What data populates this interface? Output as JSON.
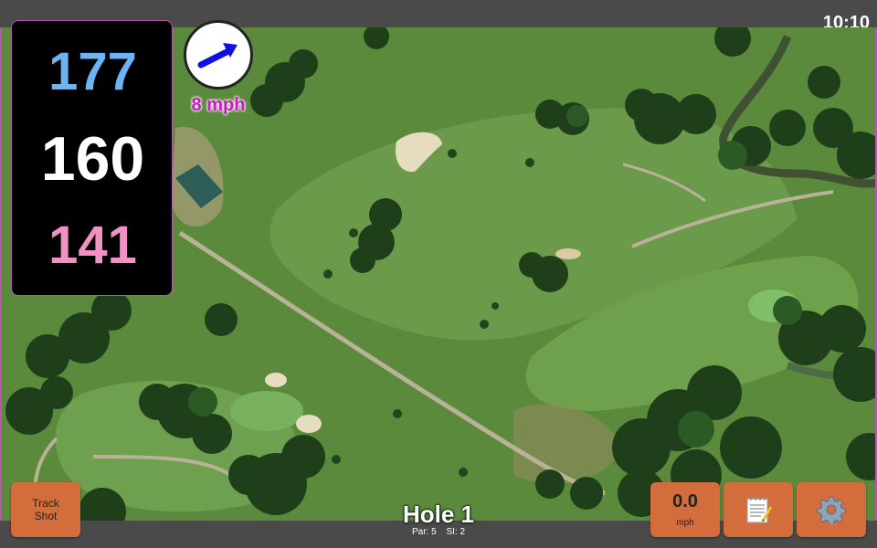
{
  "status": {
    "time": "10:10"
  },
  "distances": {
    "back": "177",
    "middle": "160",
    "front": "141"
  },
  "wind": {
    "speed_label": "8 mph",
    "arrow_icon": "arrow-right-icon",
    "arrow_color": "#1010e0"
  },
  "track_shot": {
    "label_line1": "Track",
    "label_line2": "Shot"
  },
  "speed": {
    "value": "0.0",
    "unit": "mph"
  },
  "notes": {
    "icon": "notepad-icon"
  },
  "settings": {
    "icon": "gear-icon"
  },
  "hole": {
    "title": "Hole 1",
    "par": "Par: 5",
    "stroke_index": "SI: 2"
  },
  "colors": {
    "back": "#6db4f2",
    "middle": "#ffffff",
    "front": "#f391c6",
    "button": "#d36e3c",
    "wind_text": "#c41abf"
  }
}
